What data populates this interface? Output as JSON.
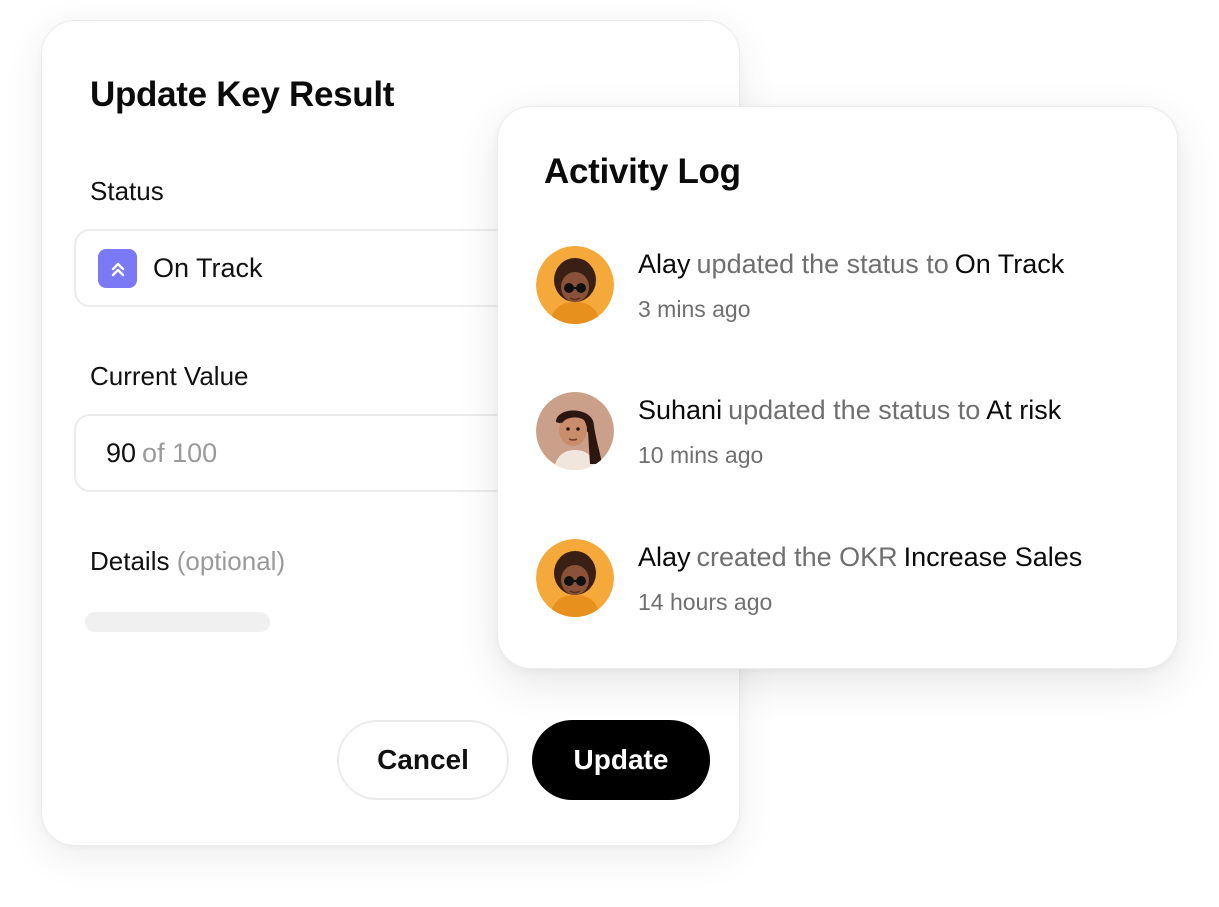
{
  "update_form": {
    "title": "Update Key Result",
    "status": {
      "label": "Status",
      "value": "On Track",
      "icon": "double-chevron-up-icon",
      "icon_color": "#7b79f6"
    },
    "current_value": {
      "label": "Current Value",
      "value": "90",
      "suffix": "of 100"
    },
    "details": {
      "label": "Details",
      "hint": "(optional)"
    },
    "buttons": {
      "cancel": "Cancel",
      "update": "Update"
    }
  },
  "activity_log": {
    "title": "Activity Log",
    "entries": [
      {
        "user": "Alay",
        "action": "updated the status to",
        "target": "On Track",
        "time": "3 mins ago",
        "avatar": "avatar-icon"
      },
      {
        "user": "Suhani",
        "action": "updated the status to",
        "target": "At risk",
        "time": "10 mins ago",
        "avatar": "avatar-icon"
      },
      {
        "user": "Alay",
        "action": "created the OKR",
        "target": "Increase Sales",
        "time": "14 hours ago",
        "avatar": "avatar-icon"
      }
    ]
  },
  "colors": {
    "primary_button": "#000000",
    "status_accent": "#7b79f6",
    "avatar_alay_bg": "#f6a93b",
    "avatar_suhani_bg": "#caa08a"
  }
}
